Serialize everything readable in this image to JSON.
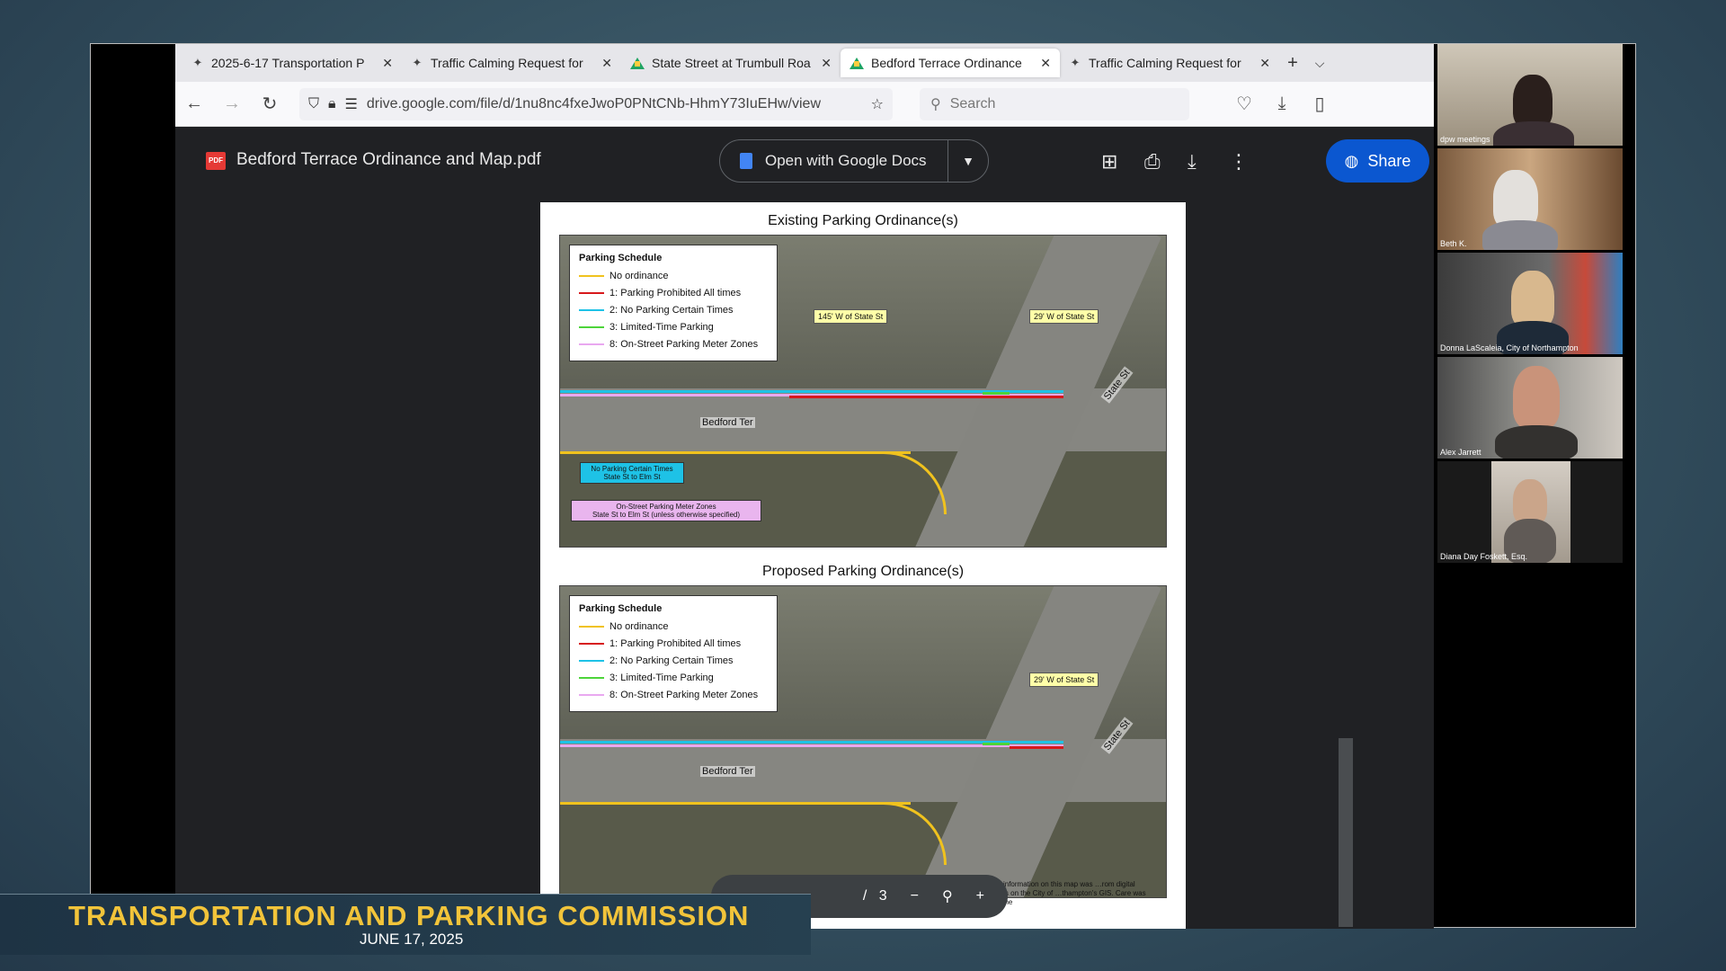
{
  "tabs": [
    {
      "title": "2025-6-17 Transportation P",
      "icon": "zoom-icon"
    },
    {
      "title": "Traffic Calming Request for",
      "icon": "zoom-icon"
    },
    {
      "title": "State Street at Trumbull Roa",
      "icon": "drive-icon"
    },
    {
      "title": "Bedford Terrace Ordinance",
      "icon": "drive-icon"
    },
    {
      "title": "Traffic Calming Request for",
      "icon": "zoom-icon"
    }
  ],
  "nav": {
    "url": "drive.google.com/file/d/1nu8nc4fxeJwoP0PNtCNb-HhmY73IuEHw/view",
    "search_placeholder": "Search"
  },
  "viewer": {
    "file_name": "Bedford Terrace Ordinance and Map.pdf",
    "pdf_badge": "PDF",
    "open_with": "Open with Google Docs",
    "share": "Share",
    "page_total": "3",
    "page_sep": "/"
  },
  "pdf": {
    "existing_title": "Existing Parking Ordinance(s)",
    "proposed_title": "Proposed Parking Ordinance(s)",
    "legend_title": "Parking Schedule",
    "legend": [
      {
        "label": "No ordinance",
        "color": "#f0c21e"
      },
      {
        "label": "1: Parking Prohibited All times",
        "color": "#d7191c"
      },
      {
        "label": "2: No Parking Certain Times",
        "color": "#1ec2e6"
      },
      {
        "label": "3: Limited-Time Parking",
        "color": "#4dd43a"
      },
      {
        "label": "8: On-Street Parking Meter Zones",
        "color": "#e9a8f0"
      }
    ],
    "label_145": "145' W of State St",
    "label_29": "29' W of State St",
    "street_bedford": "Bedford Ter",
    "street_state": "State St",
    "cyan_box": "No Parking Certain Times\nState St to Elm St",
    "pink_box": "On-Street Parking Meter Zones\nState St to Elm St (unless otherwise specified)",
    "disclaimer": "…r: The information on this map was …rom digital databases on the City of …thampton's GIS. Care was taken in the"
  },
  "participants": [
    {
      "name": "dpw meetings"
    },
    {
      "name": "Beth K."
    },
    {
      "name": "Donna LaScaleia, City of Northampton"
    },
    {
      "name": "Alex Jarrett"
    },
    {
      "name": "Diana Day Foskett, Esq."
    }
  ],
  "banner": {
    "title": "TRANSPORTATION AND PARKING COMMISSION",
    "date": "JUNE 17, 2025"
  }
}
